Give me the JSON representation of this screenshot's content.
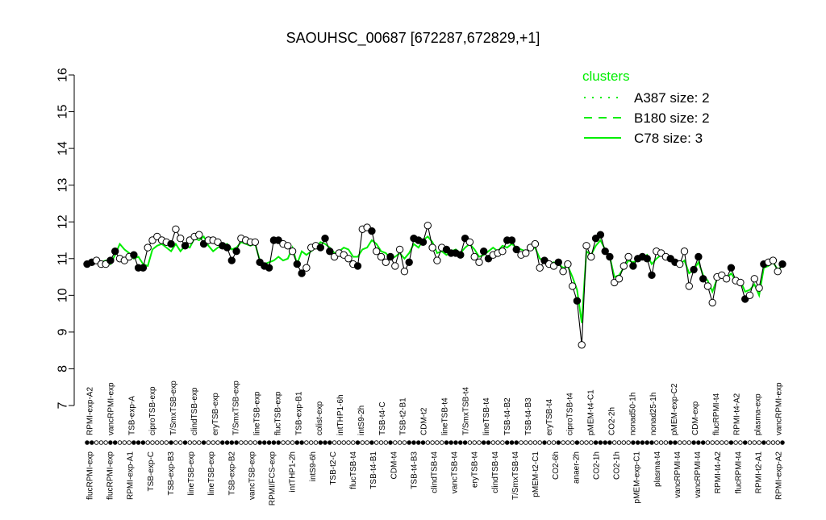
{
  "chart_data": {
    "type": "line",
    "title": "SAOUHSC_00687 [672287,672829,+1]",
    "ylim": [
      7,
      16
    ],
    "yticks": [
      7,
      8,
      9,
      10,
      11,
      12,
      13,
      14,
      15,
      16
    ],
    "top_labels": [
      "RPMI-exp-A2",
      "vancRPMI-exp",
      "TSB-exp-A",
      "ciproTSB-exp",
      "T/SmxTSB-exp",
      "clindTSB-exp",
      "eryTSB-exp",
      "T/SmxTSB-exp",
      "lineTSB-exp",
      "flucTSB-exp",
      "TSB-exp-B1",
      "colist-exp",
      "intTHP1-6h",
      "intS9-2h",
      "TSB-t4-C",
      "TSB-t2-B1",
      "CDM-t2",
      "lineTSB-t4",
      "T/SmxTSB-t4",
      "lineTSB-t4",
      "TSB-t4-B2",
      "TSB-t4-B3",
      "eryTSB-t4",
      "ciproTSB-t4",
      "pMEM-t4-C1",
      "CO2-2h",
      "nonad50-1h",
      "nonad25-1h",
      "pMEM-exp-C2",
      "CDM-exp",
      "flucRPMI-t4",
      "RPMI-t4-A2",
      "plasma-exp",
      "vancRPMI-exp"
    ],
    "bottom_labels": [
      "flucRPMI-exp",
      "flucRPMI-exp",
      "RPMI-exp-A1",
      "TSB-exp-C",
      "TSB-exp-B3",
      "lineTSB-exp",
      "lineTSB-exp",
      "TSB-exp-B2",
      "vancTSB-exp",
      "RPMI/FCS-exp",
      "intTHP1-2h",
      "intS9-6h",
      "TSB-t2-C",
      "flucTSB-t4",
      "TSB-t4-B1",
      "CDM-t4",
      "TSB-t4-B3",
      "clindTSB-t4",
      "vancTSB-t4",
      "eryTSB-t4",
      "clindTSB-t4",
      "T/SmxTSB-t4",
      "pMEM-t2-C1",
      "CO2-6h",
      "anaer-2h",
      "CO2-1h",
      "CO2-1h",
      "pMEM-exp-C1",
      "plasma-t4",
      "vancRPMI-t4",
      "vancRPMI-t4",
      "RPMI-t4-A2",
      "flucRPMI-t4",
      "RPMI-t2-A1",
      "RPMI-exp-A2"
    ],
    "legend": {
      "title": "clusters",
      "position": "top-right",
      "entries": [
        {
          "label": "A387 size: 2",
          "style": "dotted"
        },
        {
          "label": "B180 size: 2",
          "style": "dashed"
        },
        {
          "label": "C78 size: 3",
          "style": "solid"
        }
      ],
      "color": "#00ee00"
    },
    "grid": false,
    "series": [
      {
        "values": [
          10.85,
          10.9,
          10.95,
          10.85,
          10.85,
          10.95,
          11.2,
          11.0,
          10.95,
          11.05,
          11.1,
          10.75,
          10.75,
          11.3,
          11.5,
          11.6,
          11.5,
          11.45,
          11.4,
          11.8,
          11.55,
          11.35,
          11.5,
          11.6,
          11.65,
          11.4,
          11.5,
          11.5,
          11.45,
          11.35,
          11.3,
          10.95,
          11.2,
          11.55,
          11.5,
          11.45,
          11.45,
          10.9,
          10.8,
          10.75,
          11.5,
          11.5,
          11.4,
          11.35,
          11.2,
          10.85,
          10.6,
          10.75,
          11.3,
          11.35,
          11.3,
          11.55,
          11.2,
          11.05,
          11.15,
          11.1,
          11.0,
          10.85,
          10.8,
          11.8,
          11.85,
          11.75,
          11.2,
          11.05,
          10.9,
          11.05,
          10.8,
          11.25,
          10.65,
          10.9,
          11.55,
          11.5,
          11.45,
          11.9,
          11.3,
          10.95,
          11.3,
          11.25,
          11.15,
          11.15,
          11.1,
          11.55,
          11.45,
          11.05,
          10.9,
          11.2,
          11.0,
          11.1,
          11.15,
          11.2,
          11.5,
          11.5,
          11.25,
          11.1,
          11.15,
          11.3,
          11.4,
          10.75,
          10.95,
          10.85,
          10.8,
          10.9,
          10.65,
          10.85,
          10.25,
          9.85,
          8.65,
          11.35,
          11.05,
          11.55,
          11.65,
          11.2,
          11.05,
          10.35,
          10.45,
          10.8,
          11.05,
          10.8,
          11.0,
          11.05,
          11.0,
          10.55,
          11.2,
          11.15,
          11.05,
          11.0,
          10.9,
          10.85,
          11.2,
          10.25,
          10.7,
          11.05,
          10.45,
          10.25,
          9.8,
          10.5,
          10.55,
          10.45,
          10.75,
          10.4,
          10.35,
          9.9,
          10.0,
          10.45,
          10.2,
          10.85,
          10.9,
          10.95,
          10.65,
          10.85
        ],
        "cluster_values": [
          10.85,
          10.85,
          10.9,
          10.9,
          10.95,
          10.85,
          11.1,
          11.4,
          11.25,
          11.15,
          11.0,
          11.05,
          10.85,
          10.8,
          11.25,
          11.35,
          11.4,
          11.3,
          11.2,
          11.4,
          11.2,
          11.35,
          11.3,
          11.55,
          11.5,
          11.6,
          11.35,
          11.2,
          11.3,
          11.35,
          11.4,
          11.25,
          11.3,
          11.45,
          11.4,
          11.35,
          11.4,
          10.95,
          10.85,
          10.9,
          10.95,
          11.05,
          10.95,
          11.0,
          11.3,
          10.85,
          11.2,
          11.1,
          11.2,
          11.3,
          11.45,
          11.4,
          11.3,
          11.15,
          11.2,
          11.3,
          11.25,
          11.05,
          11.05,
          11.25,
          11.3,
          11.5,
          11.4,
          11.2,
          11.15,
          11.0,
          11.05,
          11.15,
          11.0,
          11.15,
          11.4,
          11.3,
          11.5,
          11.6,
          11.45,
          11.15,
          11.2,
          11.1,
          11.2,
          11.25,
          11.15,
          11.3,
          11.4,
          11.25,
          11.05,
          11.1,
          11.2,
          11.3,
          11.2,
          11.35,
          11.3,
          11.4,
          11.3,
          11.25,
          11.2,
          11.25,
          11.3,
          11.0,
          10.95,
          10.85,
          10.9,
          10.85,
          10.75,
          10.8,
          10.5,
          10.15,
          9.25,
          11.2,
          11.1,
          11.35,
          11.5,
          11.25,
          11.05,
          10.5,
          10.55,
          10.75,
          10.95,
          10.9,
          10.95,
          11.0,
          11.1,
          10.85,
          11.0,
          11.1,
          11.0,
          10.95,
          10.9,
          10.85,
          10.95,
          10.6,
          10.7,
          10.9,
          10.55,
          10.4,
          10.1,
          10.45,
          10.5,
          10.45,
          10.6,
          10.4,
          10.4,
          10.1,
          10.15,
          10.3,
          10.0,
          10.75,
          10.8,
          10.9,
          10.7,
          10.8
        ]
      }
    ]
  }
}
